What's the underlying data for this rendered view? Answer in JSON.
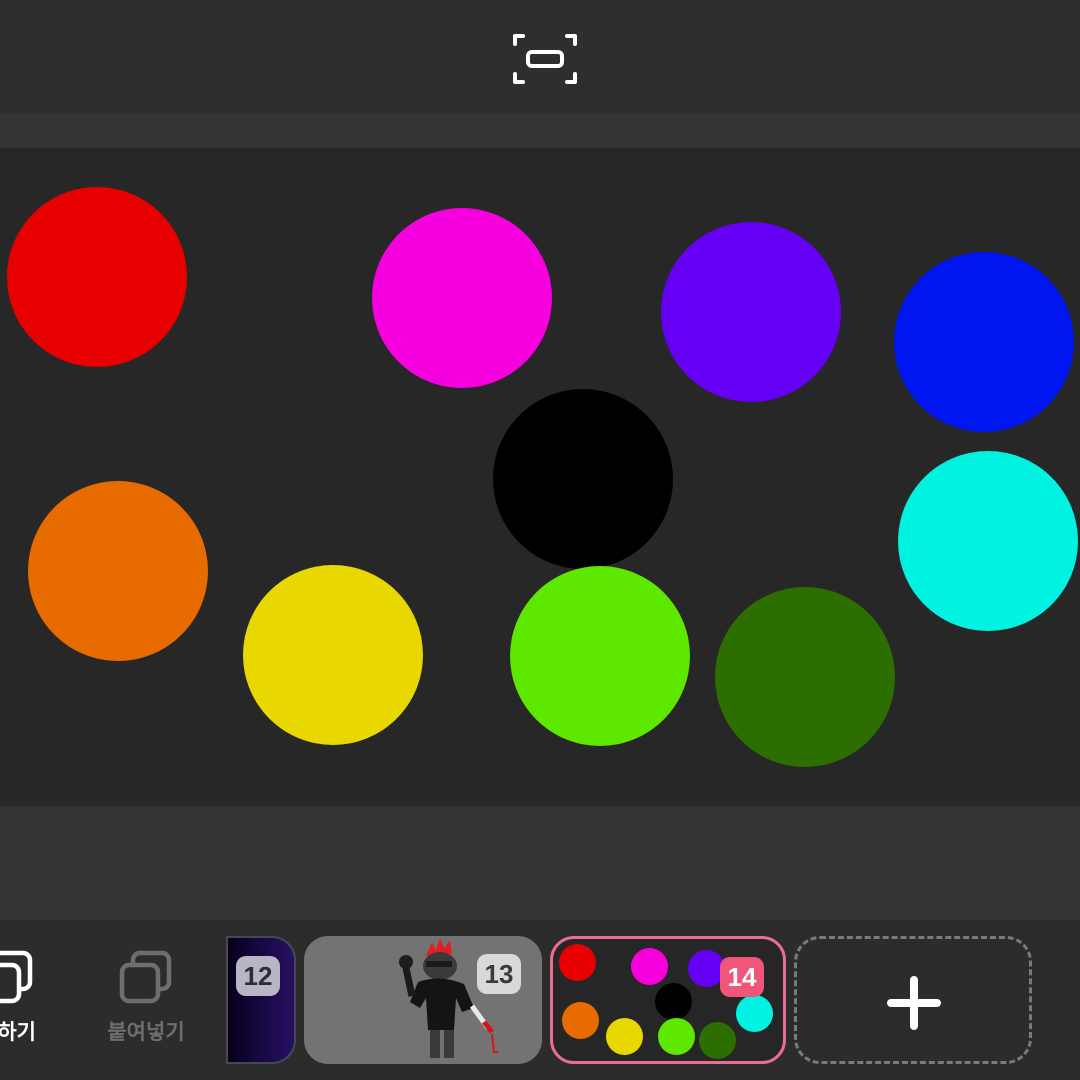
{
  "topbar": {
    "fit_button_icon": "fit-to-screen-icon"
  },
  "canvas": {
    "background": "#272727",
    "circles": [
      {
        "name": "red",
        "color": "#e80000"
      },
      {
        "name": "magenta",
        "color": "#f700e0"
      },
      {
        "name": "purple",
        "color": "#6500f5"
      },
      {
        "name": "blue",
        "color": "#0016f0"
      },
      {
        "name": "black",
        "color": "#000000"
      },
      {
        "name": "cyan",
        "color": "#00f2e0"
      },
      {
        "name": "orange",
        "color": "#e86b00"
      },
      {
        "name": "yellow",
        "color": "#e8d800"
      },
      {
        "name": "lime",
        "color": "#5ee800"
      },
      {
        "name": "dark-green",
        "color": "#2c6e00"
      }
    ]
  },
  "toolbar": {
    "copy_label": "사하기",
    "copy_icon": "copy-icon",
    "paste_label": "붙여넣기",
    "paste_icon": "paste-icon"
  },
  "frames": [
    {
      "number": "12",
      "state": "normal"
    },
    {
      "number": "13",
      "state": "normal",
      "thumbnail": "character-drawing"
    },
    {
      "number": "14",
      "state": "selected",
      "thumbnail": "colored-circles"
    }
  ],
  "add_frame": {
    "icon": "plus-icon"
  },
  "colors": {
    "selected_frame_border": "#e8708e",
    "selected_badge": "#f0557a",
    "toolbar_active_text": "#ffffff",
    "toolbar_disabled_text": "#6e6e6e"
  }
}
